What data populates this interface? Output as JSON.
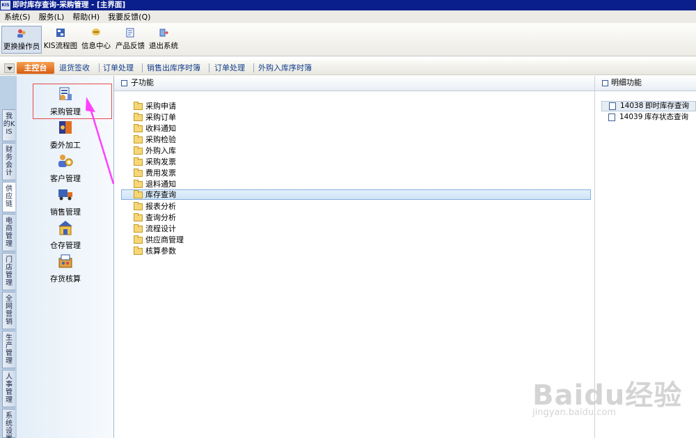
{
  "window": {
    "app_badge": "KIS",
    "title": "即时库存查询-采购管理 - [主界面]"
  },
  "menu": [
    "系统(S)",
    "服务(L)",
    "帮助(H)",
    "我要反馈(Q)"
  ],
  "toolbar": [
    {
      "label": "更换操作员",
      "icon": "user-switch-icon",
      "active": true
    },
    {
      "label": "KIS流程图",
      "icon": "flowchart-icon"
    },
    {
      "label": "信息中心",
      "icon": "message-icon"
    },
    {
      "label": "产品反馈",
      "icon": "feedback-icon"
    },
    {
      "label": "退出系统",
      "icon": "exit-icon"
    }
  ],
  "tabs": [
    "主控台",
    "退货签收",
    "订单处理",
    "销售出库序时簿",
    "订单处理",
    "外购入库序时簿"
  ],
  "side_tabs": [
    "我的KIS",
    "财务会计",
    "供应链",
    "电商管理",
    "门店管理",
    "全网营销",
    "生产管理",
    "人事管理",
    "系统设置"
  ],
  "nav_items": [
    "采购管理",
    "委外加工",
    "客户管理",
    "销售管理",
    "仓存管理",
    "存货核算"
  ],
  "sub_panel": {
    "title": "子功能",
    "items": [
      "采购申请",
      "采购订单",
      "收料通知",
      "采购检验",
      "外购入库",
      "采购发票",
      "费用发票",
      "退料通知",
      "库存查询",
      "报表分析",
      "查询分析",
      "流程设计",
      "供应商管理",
      "核算参数"
    ],
    "selected": "库存查询"
  },
  "detail_panel": {
    "title": "明细功能",
    "items": [
      {
        "code": "14038",
        "name": "即时库存查询"
      },
      {
        "code": "14039",
        "name": "库存状态查询"
      }
    ]
  },
  "watermark": {
    "brand": "Baidu经验",
    "url": "jingyan.baidu.com"
  },
  "colors": {
    "titlebar": "#0a1e8c",
    "main_tab": "#e6742a",
    "selection": "#cfe4f7",
    "annotation": "#ff40ff"
  }
}
